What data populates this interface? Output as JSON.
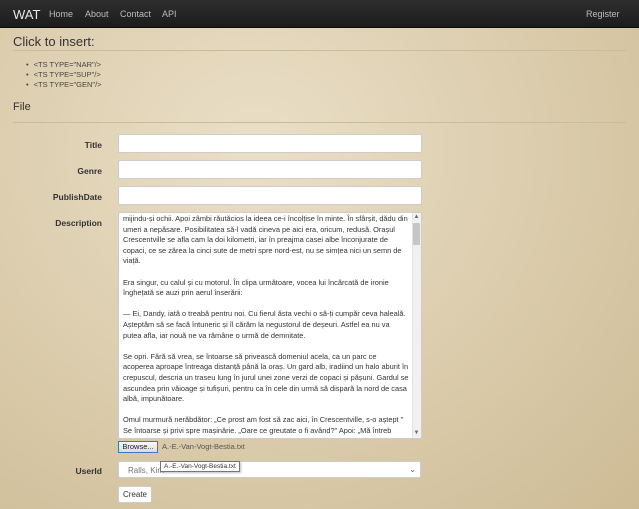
{
  "navbar": {
    "brand": "WAT",
    "links": [
      "Home",
      "About",
      "Contact",
      "API"
    ],
    "register": "Register"
  },
  "insert": {
    "heading": "Click to insert:",
    "items": [
      "<TS TYPE=\"NAR\"/>",
      "<TS TYPE=\"SUP\"/>",
      "<TS TYPE=\"GEN\"/>"
    ]
  },
  "file_label": "File",
  "form": {
    "title_label": "Title",
    "genre_label": "Genre",
    "publishdate_label": "PublishDate",
    "description_label": "Description",
    "userid_label": "UserId",
    "title_value": "",
    "genre_value": "",
    "publishdate_value": "",
    "description_text": "mijindu-și ochii. Apoi zâmbi răutăcios la ideea ce-i încolțise în minte. În sfârșit, dădu din umeri a nepăsare. Posibilitatea să-l vadă cineva pe aici era, oricum, redusă. Orașul Crescentville se afla cam la doi kilometri, iar în preajma casei albe înconjurate de copaci, ce se zărea la cinci sute de metri spre nord-est, nu se simțea nici un semn de viață.\n\nEra singur, cu calul și cu motorul. În clipa următoare, vocea lui încărcată de ironie înghețată se auzi prin aerul înserării:\n\n— Ei, Dandy, iată o treabă pentru noi. Cu fierul ăsta vechi o să-ți cumpăr ceva haleală. Așteptăm să se facă întuneric și îl cărăm la negustorul de deșeuri. Astfel ea nu va putea afla, iar nouă ne va rămâne o urmă de demnitate.\n\nSe opri. Fără să vrea, se întoarse să privească domeniul acela, ca un parc ce acoperea aproape întreaga distanță până la oraș. Un gard alb, iradiind un halo aburit în crepuscul, descria un traseu lung în jurul unei zone verzi de copaci și pășuni. Gardul se ascundea prin văioage și tufișuri, pentru ca în cele din urmă să dispară la nord de casa albă, impunătoare.\n\nOmul murmură nerăbdător: „Ce prost am fost să zac aici, în Crescentville, s-o aștept \" Se întoarse și privi spre mașinărie. „Oare ce greutate o fi având?\" Apoi: „Mă întreb",
    "browse_label": "Browse...",
    "file_name": "A.-E.-Van-Vogt-Bestia.txt",
    "tooltip": "A.-E.-Van-Vogt-Bestia.txt",
    "userid_value": "Ralls, Kim",
    "create_label": "Create"
  }
}
